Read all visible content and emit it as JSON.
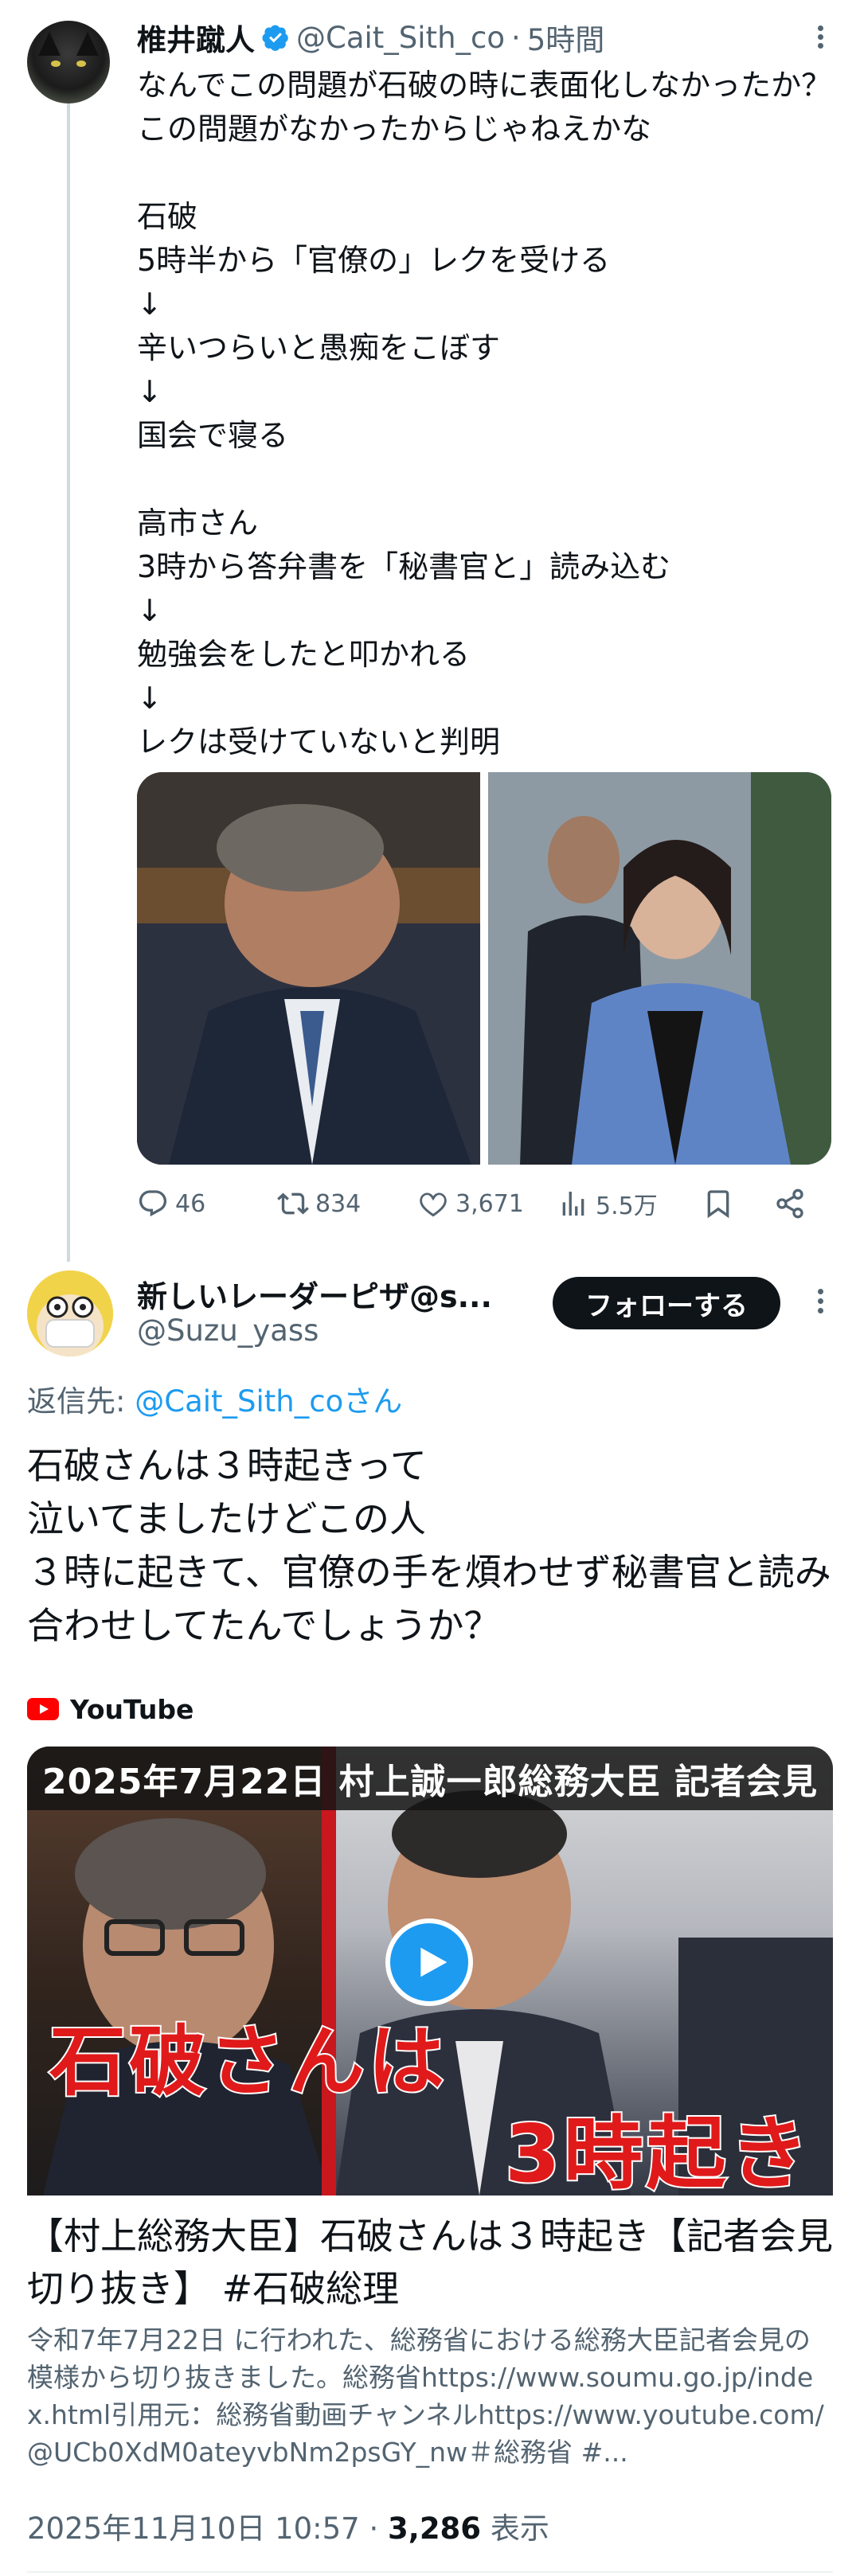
{
  "parent_tweet": {
    "author_name": "椎井蹴人",
    "handle": "@Cait_Sith_co",
    "separator": "·",
    "time": "5時間",
    "text": "なんでこの問題が石破の時に表面化しなかったか？この問題がなかったからじゃねえかな\n\n石破\n5時半から「官僚の」レクを受ける\n↓\n辛いつらいと愚痴をこぼす\n↓\n国会で寝る\n\n高市さん\n3時から答弁書を「秘書官と」読み込む\n↓\n勉強会をしたと叩かれる\n↓\nレクは受けていないと判明",
    "stats": {
      "replies": "46",
      "reposts": "834",
      "likes": "3,671",
      "views": "5.5万"
    }
  },
  "reply_tweet": {
    "author_name": "新しいレーダーピザ@s...",
    "handle": "@Suzu_yass",
    "follow_label": "フォローする",
    "reply_to_prefix": "返信先: ",
    "reply_to_handle": "@Cait_Sith_coさん",
    "text": "石破さんは３時起きって\n泣いてましたけどこの人\n３時に起きて、官僚の手を煩わせず秘書官と読み合わせしてたんでしょうか？",
    "link_card": {
      "source": "YouTube",
      "thumbnail_caption": "2025年7月22日 村上誠一郎総務大臣 記者会見",
      "thumbnail_overlay_1": "石破さんは",
      "thumbnail_overlay_2": "3時起き",
      "title": "【村上総務大臣】石破さんは３時起き【記者会見切り抜き】 #石破総理",
      "description": "令和7年7月22日 に行われた、総務省における総務大臣記者会見の模様から切り抜きました。総務省https://www.soumu.go.jp/index.html引用元：総務省動画チャンネルhttps://www.youtube.com/@UCb0XdM0ateyvbNm2psGY_nw＃総務省 #..."
    },
    "timestamp": "2025年11月10日 10:57",
    "meta_separator": " · ",
    "view_count": "3,286",
    "views_label": " 表示"
  },
  "colors": {
    "accent_blue": "#1d9bf0",
    "text_primary": "#0f1419",
    "text_secondary": "#536471",
    "follow_button_bg": "#0f1419",
    "youtube_red": "#ff0000"
  },
  "icons": [
    "verified-badge-icon",
    "more-options-icon",
    "reply-icon",
    "repost-icon",
    "like-icon",
    "views-icon",
    "bookmark-icon",
    "share-icon",
    "youtube-logo-icon",
    "play-icon"
  ]
}
